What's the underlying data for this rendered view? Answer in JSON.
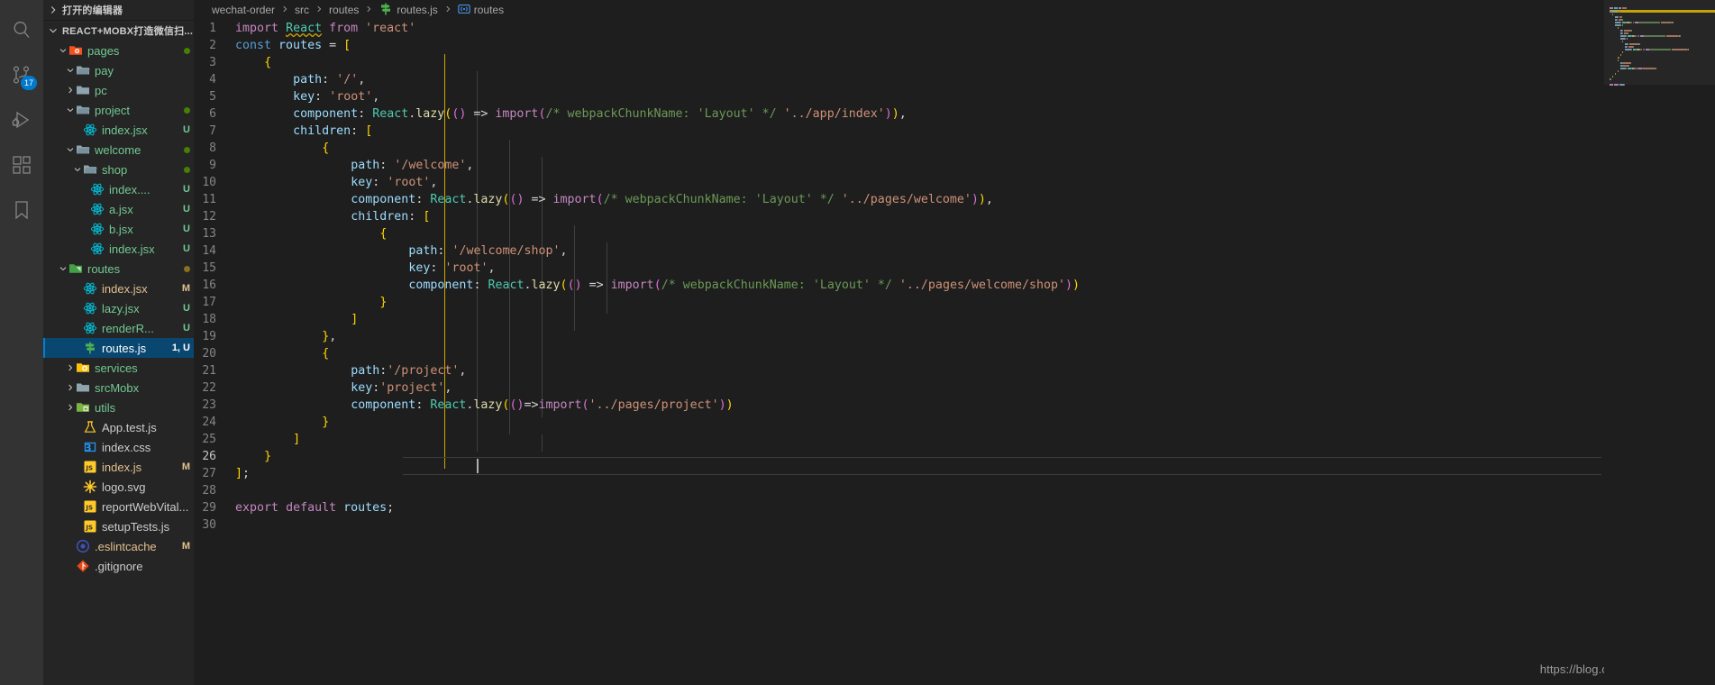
{
  "activitybar": {
    "items": [
      {
        "name": "search-icon",
        "label": "Search",
        "badge": null
      },
      {
        "name": "source-control-icon",
        "label": "Source Control",
        "badge": "17"
      },
      {
        "name": "run-and-debug-icon",
        "label": "Run and Debug",
        "badge": null
      },
      {
        "name": "extensions-icon",
        "label": "Extensions",
        "badge": null
      },
      {
        "name": "bookmarks-icon",
        "label": "Bookmarks",
        "badge": null
      }
    ]
  },
  "sidebar": {
    "open_editors_label": "打开的编辑器",
    "project_label": "REACT+MOBX打造微信扫...",
    "tree": [
      {
        "label": "pages",
        "indent": 2,
        "type": "folder-open-red",
        "chevron": "down",
        "deco": "",
        "dot": "#487e02"
      },
      {
        "label": "pay",
        "indent": 3,
        "type": "folder-open",
        "chevron": "down",
        "deco": "",
        "dot": ""
      },
      {
        "label": "pc",
        "indent": 3,
        "type": "folder",
        "chevron": "right",
        "deco": "",
        "dot": ""
      },
      {
        "label": "project",
        "indent": 3,
        "type": "folder-open",
        "chevron": "down",
        "deco": "",
        "dot": "#487e02"
      },
      {
        "label": "index.jsx",
        "indent": 4,
        "type": "react",
        "chevron": "",
        "deco": "U",
        "dot": ""
      },
      {
        "label": "welcome",
        "indent": 3,
        "type": "folder-open",
        "chevron": "down",
        "deco": "",
        "dot": "#487e02"
      },
      {
        "label": "shop",
        "indent": 4,
        "type": "folder-open",
        "chevron": "down",
        "deco": "",
        "dot": "#487e02"
      },
      {
        "label": "index....",
        "indent": 5,
        "type": "react",
        "chevron": "",
        "deco": "U",
        "dot": ""
      },
      {
        "label": "a.jsx",
        "indent": 5,
        "type": "react",
        "chevron": "",
        "deco": "U",
        "dot": ""
      },
      {
        "label": "b.jsx",
        "indent": 5,
        "type": "react",
        "chevron": "",
        "deco": "U",
        "dot": ""
      },
      {
        "label": "index.jsx",
        "indent": 5,
        "type": "react",
        "chevron": "",
        "deco": "U",
        "dot": ""
      },
      {
        "label": "routes",
        "indent": 2,
        "type": "folder-open-green",
        "chevron": "down",
        "deco": "",
        "dot": "#8a7019"
      },
      {
        "label": "index.jsx",
        "indent": 4,
        "type": "react",
        "chevron": "",
        "deco": "M",
        "dot": ""
      },
      {
        "label": "lazy.jsx",
        "indent": 4,
        "type": "react",
        "chevron": "",
        "deco": "U",
        "dot": ""
      },
      {
        "label": "renderR...",
        "indent": 4,
        "type": "react",
        "chevron": "",
        "deco": "U",
        "dot": ""
      },
      {
        "label": "routes.js",
        "indent": 4,
        "type": "routes",
        "chevron": "",
        "deco": "1, U",
        "dot": "",
        "selected": true
      },
      {
        "label": "services",
        "indent": 3,
        "type": "folder-config",
        "chevron": "right",
        "deco": "",
        "dot": ""
      },
      {
        "label": "srcMobx",
        "indent": 3,
        "type": "folder",
        "chevron": "right",
        "deco": "",
        "dot": ""
      },
      {
        "label": "utils",
        "indent": 3,
        "type": "folder-utils",
        "chevron": "right",
        "deco": "",
        "dot": ""
      },
      {
        "label": "App.test.js",
        "indent": 4,
        "type": "test",
        "chevron": "",
        "deco": "",
        "dot": ""
      },
      {
        "label": "index.css",
        "indent": 4,
        "type": "css",
        "chevron": "",
        "deco": "",
        "dot": ""
      },
      {
        "label": "index.js",
        "indent": 4,
        "type": "js",
        "chevron": "",
        "deco": "M",
        "dot": ""
      },
      {
        "label": "logo.svg",
        "indent": 4,
        "type": "svg",
        "chevron": "",
        "deco": "",
        "dot": ""
      },
      {
        "label": "reportWebVital...",
        "indent": 4,
        "type": "js",
        "chevron": "",
        "deco": "",
        "dot": ""
      },
      {
        "label": "setupTests.js",
        "indent": 4,
        "type": "js",
        "chevron": "",
        "deco": "",
        "dot": ""
      },
      {
        "label": ".eslintcache",
        "indent": 3,
        "type": "eslint",
        "chevron": "",
        "deco": "M",
        "dot": ""
      },
      {
        "label": ".gitignore",
        "indent": 3,
        "type": "git",
        "chevron": "",
        "deco": "",
        "dot": ""
      }
    ]
  },
  "breadcrumb": {
    "items": [
      "wechat-order",
      "src",
      "routes",
      "routes.js",
      "routes"
    ]
  },
  "editor": {
    "filename": "routes.js",
    "total_lines": 30,
    "current_line": 26,
    "code": [
      {
        "n": 1,
        "text": "import React from 'react'"
      },
      {
        "n": 2,
        "text": "const routes = ["
      },
      {
        "n": 3,
        "text": "    {"
      },
      {
        "n": 4,
        "text": "        path: '/',"
      },
      {
        "n": 5,
        "text": "        key: 'root',"
      },
      {
        "n": 6,
        "text": "        component: React.lazy(() => import(/* webpackChunkName: 'Layout' */ '../app/index')),"
      },
      {
        "n": 7,
        "text": "        children: ["
      },
      {
        "n": 8,
        "text": "            {"
      },
      {
        "n": 9,
        "text": "                path: '/welcome',"
      },
      {
        "n": 10,
        "text": "                key: 'root',"
      },
      {
        "n": 11,
        "text": "                component: React.lazy(() => import(/* webpackChunkName: 'Layout' */ '../pages/welcome')),"
      },
      {
        "n": 12,
        "text": "                children: ["
      },
      {
        "n": 13,
        "text": "                    {"
      },
      {
        "n": 14,
        "text": "                        path: '/welcome/shop',"
      },
      {
        "n": 15,
        "text": "                        key: 'root',"
      },
      {
        "n": 16,
        "text": "                        component: React.lazy(() => import(/* webpackChunkName: 'Layout' */ '../pages/welcome/shop'))"
      },
      {
        "n": 17,
        "text": "                    }"
      },
      {
        "n": 18,
        "text": "                ]"
      },
      {
        "n": 19,
        "text": "            },"
      },
      {
        "n": 20,
        "text": "            {"
      },
      {
        "n": 21,
        "text": "                path:'/project',"
      },
      {
        "n": 22,
        "text": "                key:'project',"
      },
      {
        "n": 23,
        "text": "                component: React.lazy(()=>import('../pages/project'))"
      },
      {
        "n": 24,
        "text": "            }"
      },
      {
        "n": 25,
        "text": "        ]"
      },
      {
        "n": 26,
        "text": "    }"
      },
      {
        "n": 27,
        "text": "];"
      },
      {
        "n": 28,
        "text": ""
      },
      {
        "n": 29,
        "text": "export default routes;"
      },
      {
        "n": 30,
        "text": ""
      }
    ]
  },
  "watermark": {
    "text": "https://blog.csdn.net/lin_fightin"
  },
  "colors": {
    "accent": "#007acc",
    "selection": "#094771",
    "editor_bg": "#1e1e1e",
    "sidebar_bg": "#252526",
    "activitybar_bg": "#333333",
    "keyword": "#c586c0",
    "string": "#ce9178",
    "comment": "#6a9955",
    "type": "#4ec9b0",
    "variable": "#9cdcfe",
    "function": "#dcdcaa"
  }
}
